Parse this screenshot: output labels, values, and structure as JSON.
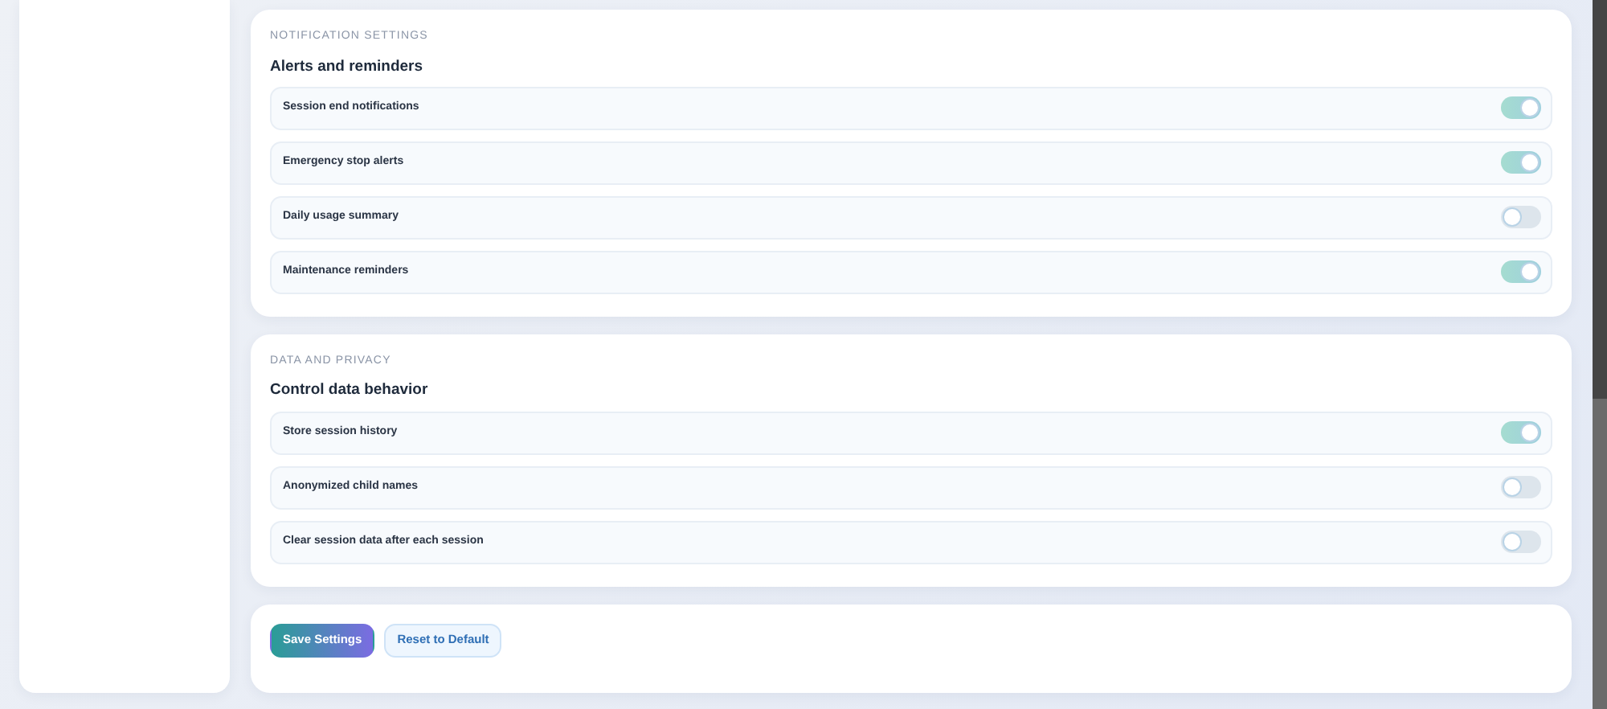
{
  "sections": [
    {
      "eyebrow": "NOTIFICATION SETTINGS",
      "title": "Alerts and reminders",
      "settings": [
        {
          "label": "Session end notifications",
          "on": true
        },
        {
          "label": "Emergency stop alerts",
          "on": true
        },
        {
          "label": "Daily usage summary",
          "on": false
        },
        {
          "label": "Maintenance reminders",
          "on": true
        }
      ]
    },
    {
      "eyebrow": "DATA AND PRIVACY",
      "title": "Control data behavior",
      "settings": [
        {
          "label": "Store session history",
          "on": true
        },
        {
          "label": "Anonymized child names",
          "on": false
        },
        {
          "label": "Clear session data after each session",
          "on": false
        }
      ]
    }
  ],
  "actions": [
    {
      "label": "Save Settings",
      "kind": "primary"
    },
    {
      "label": "Reset to Default",
      "kind": "secondary"
    }
  ]
}
